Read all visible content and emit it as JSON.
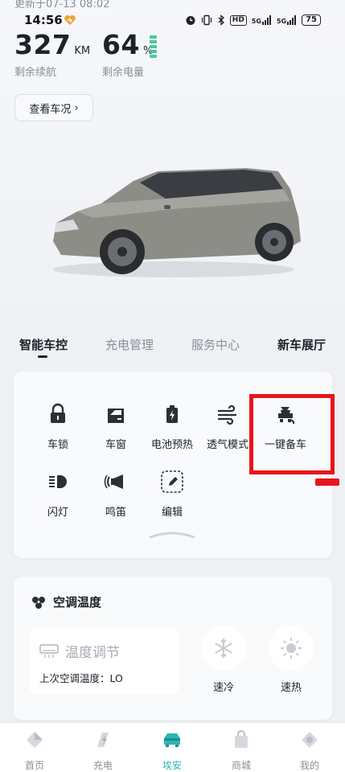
{
  "header": {
    "updated_text": "更新于07-13 08:02"
  },
  "status_bar": {
    "time": "14:56",
    "hd_label": "HD",
    "signal1": "5G",
    "signal2": "5G",
    "battery": "75"
  },
  "vehicle": {
    "range_value": "327",
    "range_unit": "KM",
    "range_label": "剩余续航",
    "battery_value": "64",
    "battery_unit": "%",
    "battery_label": "剩余电量",
    "check_status_label": "查看车况",
    "check_status_arrow": "›"
  },
  "tabs": [
    {
      "label": "智能车控"
    },
    {
      "label": "充电管理"
    },
    {
      "label": "服务中心"
    },
    {
      "label": "新车展厅"
    }
  ],
  "controls": [
    {
      "label": "车锁",
      "icon": "lock-icon"
    },
    {
      "label": "车窗",
      "icon": "car-window-icon"
    },
    {
      "label": "电池预热",
      "icon": "battery-heat-icon"
    },
    {
      "label": "透气模式",
      "icon": "wind-icon"
    },
    {
      "label": "一键备车",
      "icon": "car-prep-icon"
    },
    {
      "label": "闪灯",
      "icon": "headlight-icon"
    },
    {
      "label": "鸣笛",
      "icon": "horn-icon"
    },
    {
      "label": "编辑",
      "icon": "edit-icon"
    }
  ],
  "climate": {
    "title": "空调温度",
    "temp_adjust_label": "温度调节",
    "last_temp_label": "上次空调温度：LO",
    "cool_label": "速冷",
    "heat_label": "速热"
  },
  "bottom_nav": [
    {
      "label": "首页",
      "icon": "home-icon"
    },
    {
      "label": "充电",
      "icon": "charge-icon"
    },
    {
      "label": "埃安",
      "icon": "car-icon"
    },
    {
      "label": "商城",
      "icon": "shop-icon"
    },
    {
      "label": "我的",
      "icon": "profile-icon"
    }
  ],
  "colors": {
    "accent": "#2cb5b4",
    "battery_green": "#4cc79a",
    "highlight_red": "#e8141b"
  }
}
